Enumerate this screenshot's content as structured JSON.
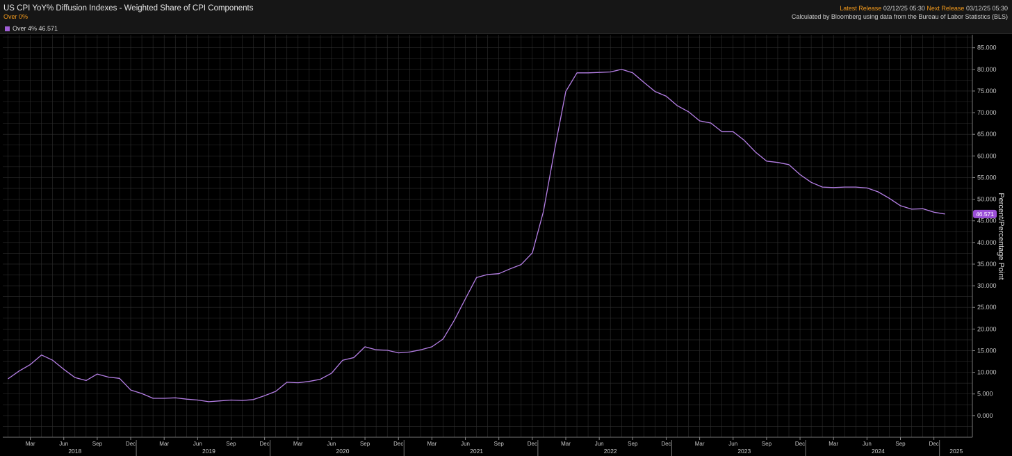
{
  "header": {
    "title": "US CPI YoY% Diffusion Indexes - Weighted Share of CPI Components",
    "subtitle": "Over 0%",
    "latest_release_label": "Latest Release",
    "latest_release_value": "02/12/25 05:30",
    "next_release_label": "Next Release",
    "next_release_value": "03/12/25 05:30",
    "source": "Calculated by Bloomberg using data from the Bureau of Labor Statistics (BLS)"
  },
  "legend": {
    "label": "Over 4%",
    "value": "46.571",
    "color": "#a05fd6"
  },
  "colors": {
    "line": "#b57fe6",
    "end_badge": "#9b4fd8",
    "grid": "#2e2e2e",
    "background": "#000000",
    "header_bg": "#161616",
    "accent_orange": "#f39a1c"
  },
  "chart_data": {
    "type": "line",
    "title": "US CPI YoY% Diffusion Indexes - Weighted Share of CPI Components",
    "xlabel": "",
    "ylabel": "Percent/Percentage Point",
    "ylim": [
      -5,
      88
    ],
    "y_ticks": [
      "0.000",
      "5.000",
      "10.000",
      "15.000",
      "20.000",
      "25.000",
      "30.000",
      "35.000",
      "40.000",
      "45.000",
      "50.000",
      "55.000",
      "60.000",
      "65.000",
      "70.000",
      "75.000",
      "80.000",
      "85.000"
    ],
    "x_ticks": [
      {
        "m": "Mar",
        "date": "2018-03"
      },
      {
        "m": "Jun",
        "date": "2018-06"
      },
      {
        "m": "Sep",
        "date": "2018-09"
      },
      {
        "m": "Dec",
        "date": "2018-12"
      },
      {
        "m": "Mar",
        "date": "2019-03"
      },
      {
        "m": "Jun",
        "date": "2019-06"
      },
      {
        "m": "Sep",
        "date": "2019-09"
      },
      {
        "m": "Dec",
        "date": "2019-12"
      },
      {
        "m": "Mar",
        "date": "2020-03"
      },
      {
        "m": "Jun",
        "date": "2020-06"
      },
      {
        "m": "Sep",
        "date": "2020-09"
      },
      {
        "m": "Dec",
        "date": "2020-12"
      },
      {
        "m": "Mar",
        "date": "2021-03"
      },
      {
        "m": "Jun",
        "date": "2021-06"
      },
      {
        "m": "Sep",
        "date": "2021-09"
      },
      {
        "m": "Dec",
        "date": "2021-12"
      },
      {
        "m": "Mar",
        "date": "2022-03"
      },
      {
        "m": "Jun",
        "date": "2022-06"
      },
      {
        "m": "Sep",
        "date": "2022-09"
      },
      {
        "m": "Dec",
        "date": "2022-12"
      },
      {
        "m": "Mar",
        "date": "2023-03"
      },
      {
        "m": "Jun",
        "date": "2023-06"
      },
      {
        "m": "Sep",
        "date": "2023-09"
      },
      {
        "m": "Dec",
        "date": "2023-12"
      },
      {
        "m": "Mar",
        "date": "2024-03"
      },
      {
        "m": "Jun",
        "date": "2024-06"
      },
      {
        "m": "Sep",
        "date": "2024-09"
      },
      {
        "m": "Dec",
        "date": "2024-12"
      }
    ],
    "year_labels": [
      {
        "label": "2018",
        "date": "2018-07"
      },
      {
        "label": "2019",
        "date": "2019-07"
      },
      {
        "label": "2020",
        "date": "2020-07"
      },
      {
        "label": "2021",
        "date": "2021-07"
      },
      {
        "label": "2022",
        "date": "2022-07"
      },
      {
        "label": "2023",
        "date": "2023-07"
      },
      {
        "label": "2024",
        "date": "2024-07"
      },
      {
        "label": "2025",
        "date": "2025-02"
      }
    ],
    "series": [
      {
        "name": "Over 4%",
        "last_value": "46.571",
        "x": [
          "2018-01",
          "2018-02",
          "2018-03",
          "2018-04",
          "2018-05",
          "2018-06",
          "2018-07",
          "2018-08",
          "2018-09",
          "2018-10",
          "2018-11",
          "2018-12",
          "2019-01",
          "2019-02",
          "2019-03",
          "2019-04",
          "2019-05",
          "2019-06",
          "2019-07",
          "2019-08",
          "2019-09",
          "2019-10",
          "2019-11",
          "2019-12",
          "2020-01",
          "2020-02",
          "2020-03",
          "2020-04",
          "2020-05",
          "2020-06",
          "2020-07",
          "2020-08",
          "2020-09",
          "2020-10",
          "2020-11",
          "2020-12",
          "2021-01",
          "2021-02",
          "2021-03",
          "2021-04",
          "2021-05",
          "2021-06",
          "2021-07",
          "2021-08",
          "2021-09",
          "2021-10",
          "2021-11",
          "2021-12",
          "2022-01",
          "2022-02",
          "2022-03",
          "2022-04",
          "2022-05",
          "2022-06",
          "2022-07",
          "2022-08",
          "2022-09",
          "2022-10",
          "2022-11",
          "2022-12",
          "2023-01",
          "2023-02",
          "2023-03",
          "2023-04",
          "2023-05",
          "2023-06",
          "2023-07",
          "2023-08",
          "2023-09",
          "2023-10",
          "2023-11",
          "2023-12",
          "2024-01",
          "2024-02",
          "2024-03",
          "2024-04",
          "2024-05",
          "2024-06",
          "2024-07",
          "2024-08",
          "2024-09",
          "2024-10",
          "2024-11",
          "2024-12",
          "2025-01"
        ],
        "values": [
          8.5,
          10.3,
          11.8,
          14.0,
          12.8,
          10.7,
          8.8,
          8.1,
          9.6,
          8.9,
          8.6,
          5.9,
          5.1,
          4.0,
          4.0,
          4.1,
          3.8,
          3.6,
          3.2,
          3.4,
          3.6,
          3.5,
          3.7,
          4.6,
          5.6,
          7.7,
          7.6,
          7.9,
          8.4,
          9.8,
          12.8,
          13.4,
          15.9,
          15.2,
          15.1,
          14.5,
          14.7,
          15.2,
          15.9,
          17.7,
          22.0,
          27.0,
          31.9,
          32.6,
          32.8,
          33.9,
          34.9,
          37.6,
          47.2,
          61.5,
          74.9,
          79.2,
          79.2,
          79.3,
          79.4,
          80.0,
          79.2,
          77.0,
          74.9,
          73.8,
          71.6,
          70.2,
          68.1,
          67.6,
          65.6,
          65.6,
          63.6,
          60.9,
          58.8,
          58.5,
          58.0,
          55.7,
          53.9,
          52.8,
          52.7,
          52.8,
          52.8,
          52.6,
          51.7,
          50.2,
          48.5,
          47.7,
          47.8,
          47.0,
          46.571
        ]
      }
    ]
  }
}
